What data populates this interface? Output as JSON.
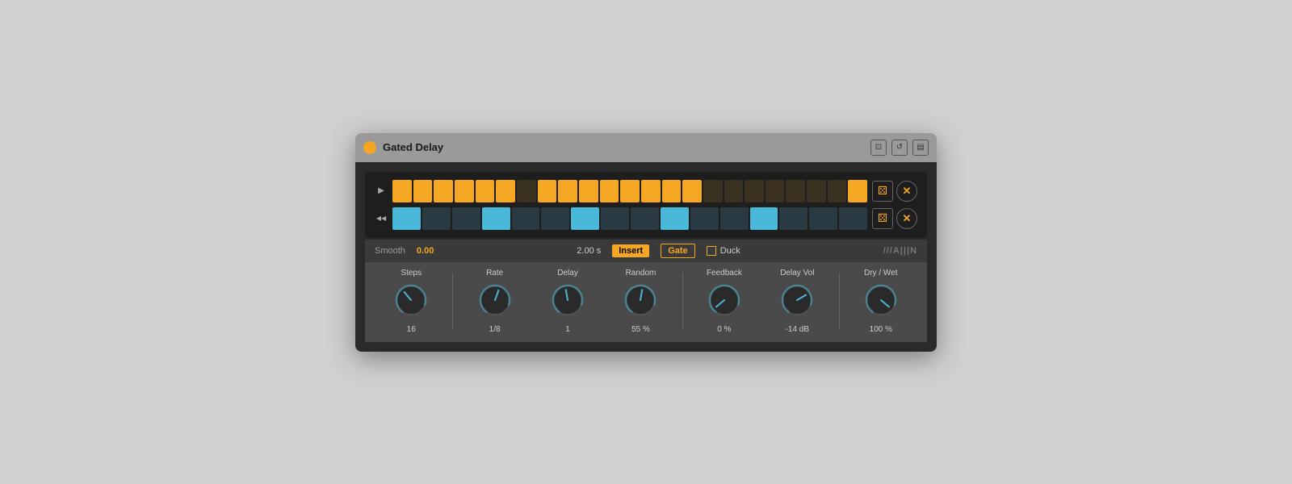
{
  "window": {
    "title": "Gated Delay"
  },
  "titlebar": {
    "power_label": "●",
    "icons": [
      "⊡",
      "↺",
      "💾"
    ]
  },
  "sequencer": {
    "row1": {
      "play_symbol": "▶",
      "cells": [
        "orange",
        "orange",
        "orange",
        "orange",
        "orange",
        "orange",
        "dark",
        "orange",
        "orange",
        "orange",
        "orange",
        "orange",
        "orange",
        "orange",
        "orange",
        "dark",
        "dark",
        "dark",
        "dark",
        "dark",
        "dark",
        "dark",
        "orange"
      ]
    },
    "row2": {
      "play_symbol": "◀◀",
      "cells": [
        "cyan",
        "dark-blue",
        "dark-blue",
        "cyan",
        "dark-blue",
        "dark-blue",
        "cyan",
        "dark-blue",
        "dark-blue",
        "cyan",
        "dark-blue",
        "dark-blue",
        "cyan",
        "dark-blue",
        "dark-blue",
        "dark-blue"
      ]
    }
  },
  "bottom_bar": {
    "smooth_label": "Smooth",
    "smooth_value": "0.00",
    "time_value": "2.00 s",
    "insert_label": "Insert",
    "gate_label": "Gate",
    "duck_label": "Duck",
    "brand": "///A|||N"
  },
  "knobs": [
    {
      "id": "steps",
      "label": "Steps",
      "value": "16",
      "angle": -40,
      "color": "#4ab8d8"
    },
    {
      "id": "rate",
      "label": "Rate",
      "value": "1/8",
      "angle": 20,
      "color": "#4ab8d8"
    },
    {
      "id": "delay",
      "label": "Delay",
      "value": "1",
      "angle": -10,
      "color": "#4ab8d8"
    },
    {
      "id": "random",
      "label": "Random",
      "value": "55 %",
      "angle": 10,
      "color": "#4ab8d8"
    },
    {
      "id": "feedback",
      "label": "Feedback",
      "value": "0 %",
      "angle": -130,
      "color": "#4ab8d8"
    },
    {
      "id": "delay-vol",
      "label": "Delay Vol",
      "value": "-14 dB",
      "angle": 60,
      "color": "#4ab8d8"
    },
    {
      "id": "dry-wet",
      "label": "Dry / Wet",
      "value": "100 %",
      "angle": 130,
      "color": "#4ab8d8"
    }
  ],
  "separators": [
    1,
    4,
    6
  ]
}
